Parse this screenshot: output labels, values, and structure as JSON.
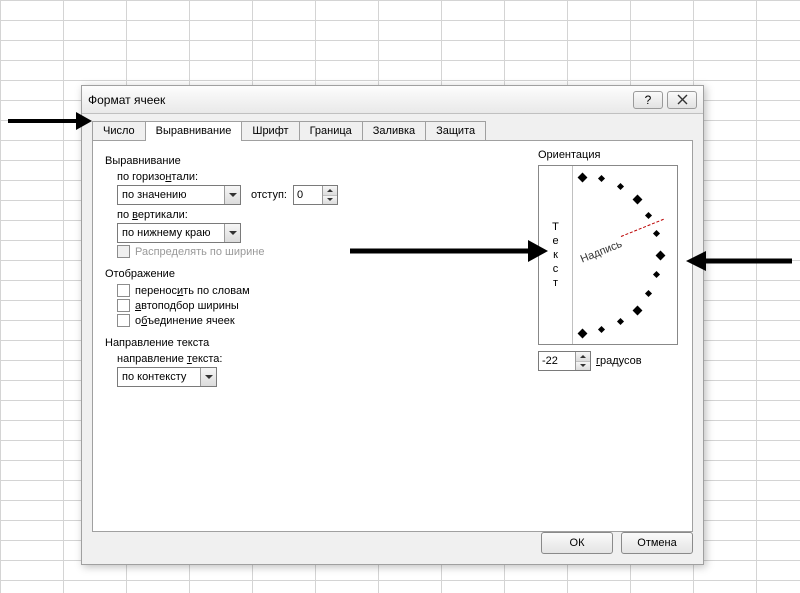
{
  "dialog": {
    "title": "Формат ячеек",
    "tabs": [
      "Число",
      "Выравнивание",
      "Шрифт",
      "Граница",
      "Заливка",
      "Защита"
    ],
    "active_tab": 1
  },
  "align": {
    "section": "Выравнивание",
    "horiz_label": "по горизонтали:",
    "horiz_value": "по значению",
    "indent_label": "отступ:",
    "indent_value": "0",
    "vert_label": "по вертикали:",
    "vert_value": "по нижнему краю",
    "distribute_label": "Распределять по ширине"
  },
  "display": {
    "section": "Отображение",
    "wrap": "переносить по словам",
    "auto": "автоподбор ширины",
    "merge": "объединение ячеек"
  },
  "textdir": {
    "section": "Направление текста",
    "label": "направление текста:",
    "value": "по контексту"
  },
  "orientation": {
    "section": "Ориентация",
    "vertical_text": [
      "Т",
      "е",
      "к",
      "с",
      "т"
    ],
    "nadpis": "Надпись",
    "degrees_value": "-22",
    "degrees_label": "градусов"
  },
  "buttons": {
    "ok": "ОК",
    "cancel": "Отмена"
  },
  "underline": {
    "horiz_n_pre": "по горизо",
    "horiz_n_u": "н",
    "horiz_n_post": "тали:",
    "vert_v_pre": "по ",
    "vert_v_u": "в",
    "vert_v_post": "ертикали:",
    "wrap_pre": "перенос",
    "wrap_u": "и",
    "wrap_post": "ть по словам",
    "auto_u": "а",
    "auto_post": "втоподбор ширины",
    "merge_pre": "о",
    "merge_u": "б",
    "merge_post": "ъединение ячеек",
    "dir_pre": "направление ",
    "dir_u": "т",
    "dir_post": "екста:",
    "deg_u": "г",
    "deg_post": "радусов"
  }
}
